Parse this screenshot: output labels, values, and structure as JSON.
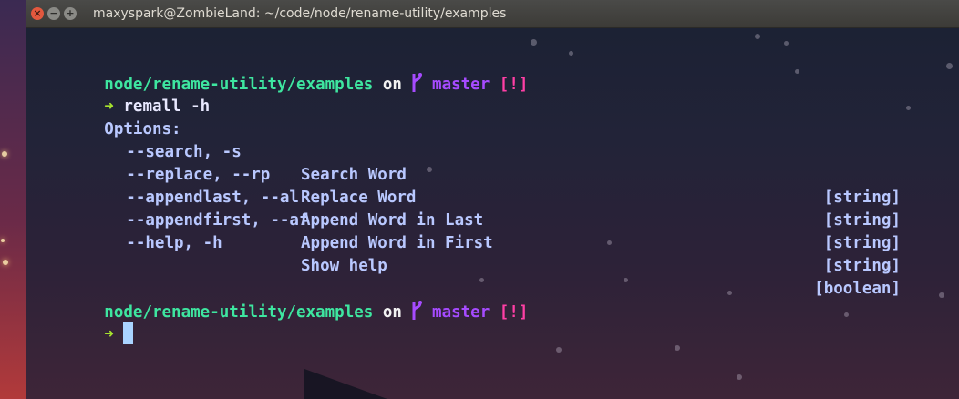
{
  "window": {
    "title": "maxyspark@ZombieLand: ~/code/node/rename-utility/examples",
    "close_glyph": "×",
    "minimize_glyph": "−",
    "maximize_glyph": "+"
  },
  "terminal": {
    "prompt1": {
      "path": "node/rename-utility/examples",
      "on": "on",
      "branch_icon": "",
      "branch": "master",
      "status": "[!]"
    },
    "command_line": {
      "arrow": "➜",
      "command": "remall -h"
    },
    "help": {
      "header": "Options:",
      "options": [
        {
          "flag": "--search, -s",
          "desc": "Search Word",
          "type": "[string]"
        },
        {
          "flag": "--replace, --rp",
          "desc": "Replace Word",
          "type": "[string]"
        },
        {
          "flag": "--appendlast, --al",
          "desc": "Append Word in Last",
          "type": "[string]"
        },
        {
          "flag": "--appendfirst, --af",
          "desc": "Append Word in First",
          "type": "[string]"
        },
        {
          "flag": "--help, -h",
          "desc": "Show help",
          "type": "[boolean]"
        }
      ]
    },
    "prompt2": {
      "path": "node/rename-utility/examples",
      "on": "on",
      "branch": "master",
      "status": "[!]"
    },
    "current_line": {
      "arrow": "➜"
    }
  },
  "colors": {
    "path": "#3ee6a0",
    "branch": "#a64bff",
    "status": "#ff3fa5",
    "arrow": "#a6e22e",
    "cursor": "#a9d3ff"
  }
}
